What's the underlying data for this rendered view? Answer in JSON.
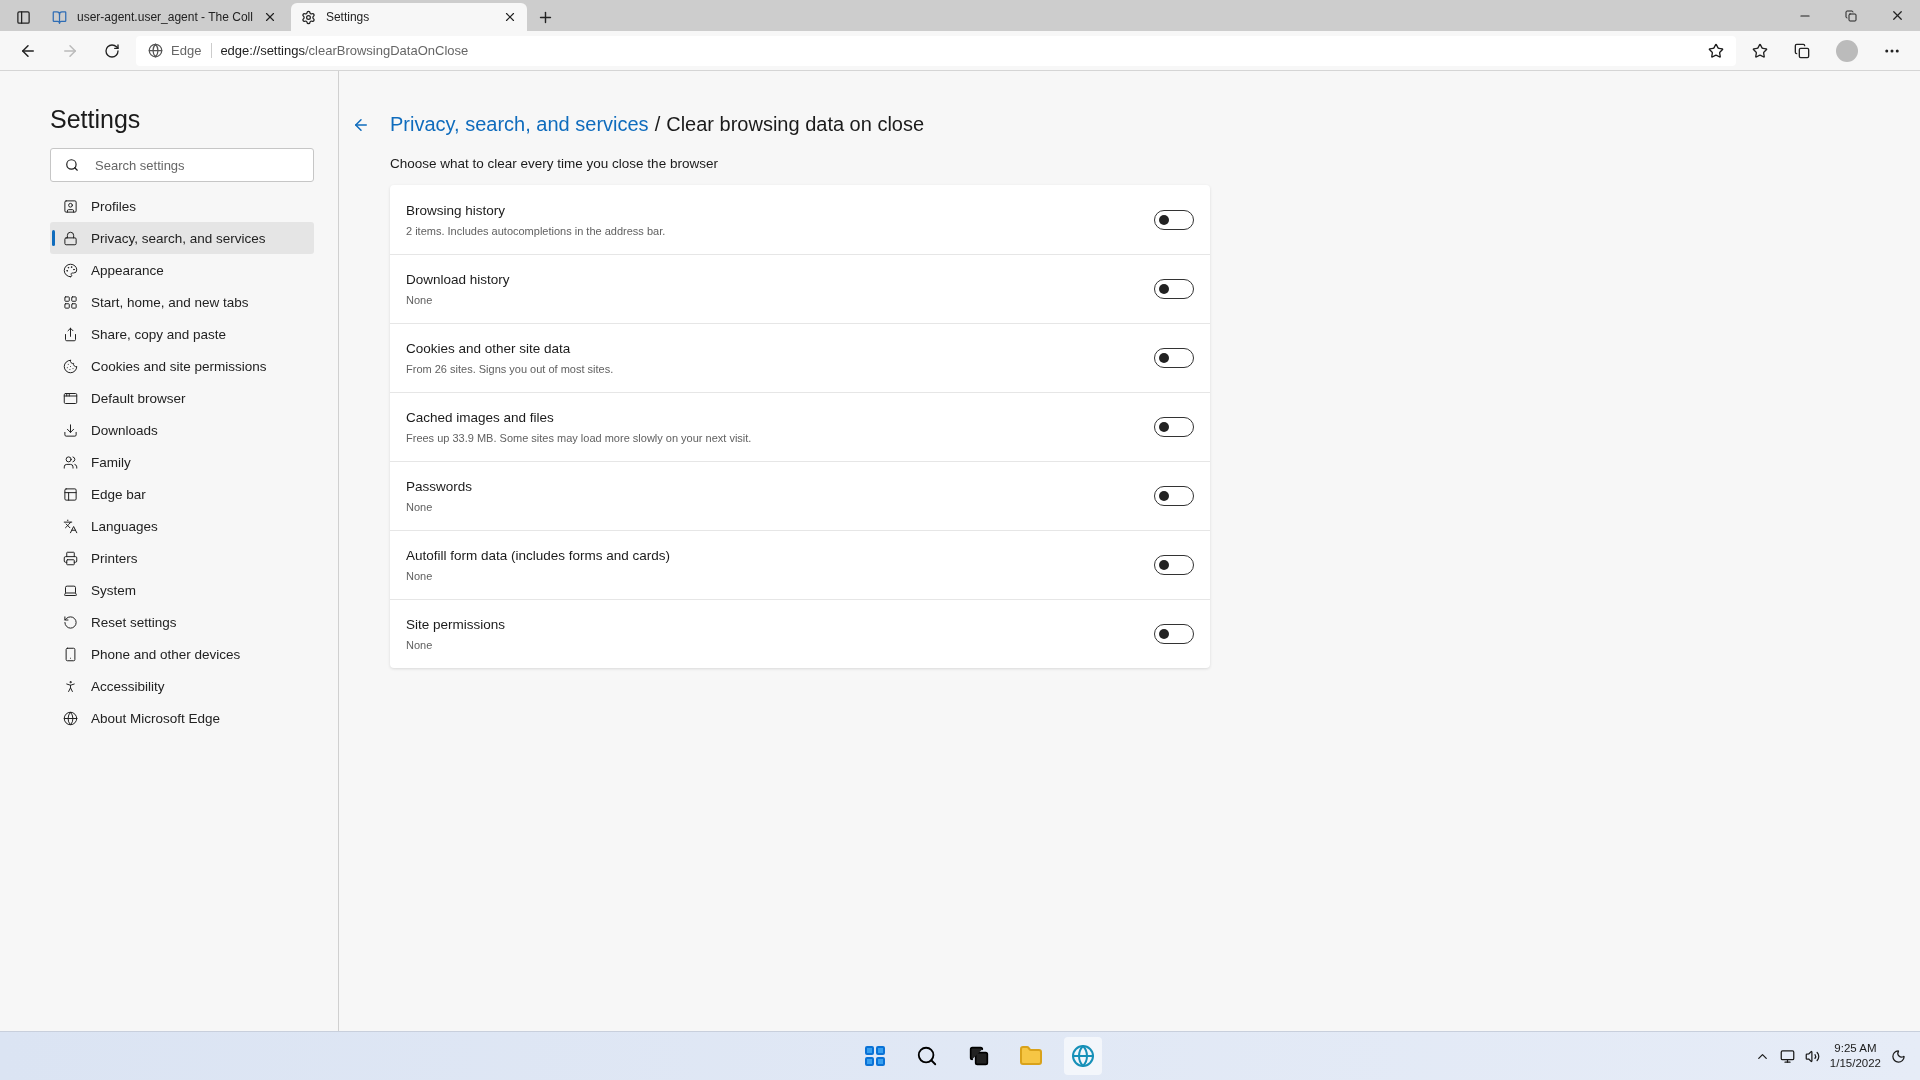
{
  "browser": {
    "tabs": [
      {
        "title": "user-agent.user_agent - The Coll",
        "selected": false
      },
      {
        "title": "Settings",
        "selected": true
      }
    ],
    "address": {
      "site_label": "Edge",
      "url_host": "edge://settings",
      "url_path": "/clearBrowsingDataOnClose"
    }
  },
  "sidebar": {
    "title": "Settings",
    "search": {
      "placeholder": "Search settings"
    },
    "items": [
      {
        "label": "Profiles",
        "selected": false
      },
      {
        "label": "Privacy, search, and services",
        "selected": true
      },
      {
        "label": "Appearance",
        "selected": false
      },
      {
        "label": "Start, home, and new tabs",
        "selected": false
      },
      {
        "label": "Share, copy and paste",
        "selected": false
      },
      {
        "label": "Cookies and site permissions",
        "selected": false
      },
      {
        "label": "Default browser",
        "selected": false
      },
      {
        "label": "Downloads",
        "selected": false
      },
      {
        "label": "Family",
        "selected": false
      },
      {
        "label": "Edge bar",
        "selected": false
      },
      {
        "label": "Languages",
        "selected": false
      },
      {
        "label": "Printers",
        "selected": false
      },
      {
        "label": "System",
        "selected": false
      },
      {
        "label": "Reset settings",
        "selected": false
      },
      {
        "label": "Phone and other devices",
        "selected": false
      },
      {
        "label": "Accessibility",
        "selected": false
      },
      {
        "label": "About Microsoft Edge",
        "selected": false
      }
    ]
  },
  "page": {
    "breadcrumb_link": "Privacy, search, and services",
    "breadcrumb_separator": "/",
    "title": "Clear browsing data on close",
    "description": "Choose what to clear every time you close the browser",
    "options": [
      {
        "title": "Browsing history",
        "detail": "2 items. Includes autocompletions in the address bar.",
        "on": false
      },
      {
        "title": "Download history",
        "detail": "None",
        "on": false
      },
      {
        "title": "Cookies and other site data",
        "detail": "From 26 sites. Signs you out of most sites.",
        "on": false
      },
      {
        "title": "Cached images and files",
        "detail": "Frees up 33.9 MB. Some sites may load more slowly on your next visit.",
        "on": false
      },
      {
        "title": "Passwords",
        "detail": "None",
        "on": false
      },
      {
        "title": "Autofill form data (includes forms and cards)",
        "detail": "None",
        "on": false
      },
      {
        "title": "Site permissions",
        "detail": "None",
        "on": false
      }
    ]
  },
  "taskbar": {
    "time": "9:25 AM",
    "date": "1/15/2022"
  }
}
